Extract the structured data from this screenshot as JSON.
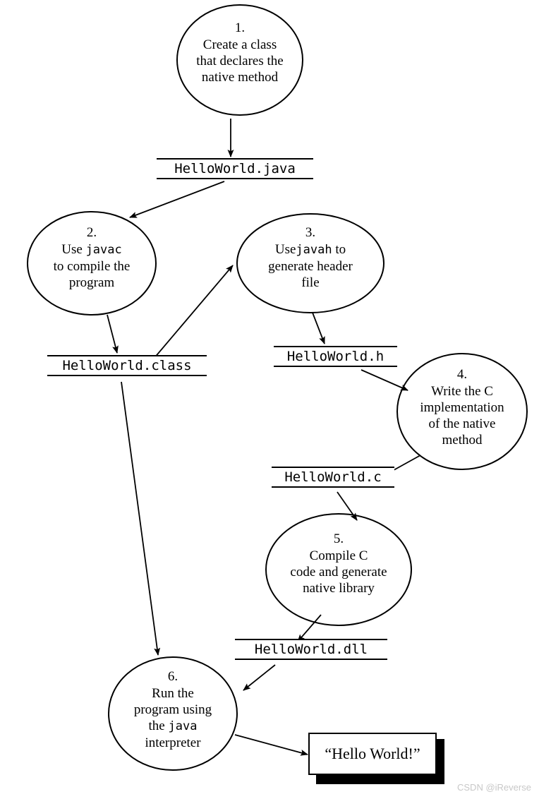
{
  "diagram": {
    "title": "JNI HelloWorld development workflow",
    "stroke_color": "#000000",
    "background_color": "#ffffff",
    "nodes": [
      {
        "id": "step-1",
        "number": "1.",
        "lines": [
          "Create a class",
          "that declares the",
          "native method"
        ],
        "shape": "ellipse"
      },
      {
        "id": "step-2",
        "number": "2.",
        "lines": [
          "Use javac",
          "to compile the",
          "program"
        ],
        "mono_word": "javac",
        "shape": "ellipse"
      },
      {
        "id": "step-3",
        "number": "3.",
        "lines": [
          "Use javah to",
          "generate header",
          "file"
        ],
        "mono_word": "javah",
        "shape": "ellipse"
      },
      {
        "id": "step-4",
        "number": "4.",
        "lines": [
          "Write the C",
          "implementation",
          "of the native",
          "method"
        ],
        "shape": "ellipse"
      },
      {
        "id": "step-5",
        "number": "5.",
        "lines": [
          "Compile C",
          "code and generate",
          "native library"
        ],
        "shape": "ellipse"
      },
      {
        "id": "step-6",
        "number": "6.",
        "lines": [
          "Run the",
          "program using",
          "the java",
          "interpreter"
        ],
        "mono_word": "java",
        "shape": "ellipse"
      }
    ],
    "node_1_num": "1.",
    "node_1_l1": "Create a class",
    "node_1_l2": "that declares the",
    "node_1_l3": "native method",
    "node_2_num": "2.",
    "node_2_l1_a": "Use ",
    "node_2_l1_b": "javac",
    "node_2_l2": "to compile the",
    "node_2_l3": "program",
    "node_3_num": "3.",
    "node_3_l1_a": "Use",
    "node_3_l1_b": "javah",
    "node_3_l1_c": " to",
    "node_3_l2": "generate header",
    "node_3_l3": "file",
    "node_4_num": "4.",
    "node_4_l1": "Write the C",
    "node_4_l2": "implementation",
    "node_4_l3": "of the native",
    "node_4_l4": "method",
    "node_5_num": "5.",
    "node_5_l1": "Compile C",
    "node_5_l2": "code and generate",
    "node_5_l3": "native library",
    "node_6_num": "6.",
    "node_6_l1": "Run the",
    "node_6_l2": "program using",
    "node_6_l3_a": "the ",
    "node_6_l3_b": "java",
    "node_6_l4": "interpreter",
    "files": {
      "java_source": "HelloWorld.java",
      "class_file": "HelloWorld.class",
      "header_file": "HelloWorld.h",
      "c_source": "HelloWorld.c",
      "library_file": "HelloWorld.dll"
    },
    "output": {
      "text": "“Hello World!”"
    },
    "edges": [
      {
        "from": "step-1",
        "to": "java_source"
      },
      {
        "from": "java_source",
        "to": "step-2"
      },
      {
        "from": "step-2",
        "to": "class_file"
      },
      {
        "from": "class_file",
        "to": "step-3"
      },
      {
        "from": "step-3",
        "to": "header_file"
      },
      {
        "from": "header_file",
        "to": "step-4"
      },
      {
        "from": "step-4",
        "to": "c_source"
      },
      {
        "from": "c_source",
        "to": "step-5"
      },
      {
        "from": "step-5",
        "to": "library_file"
      },
      {
        "from": "library_file",
        "to": "step-6"
      },
      {
        "from": "class_file",
        "to": "step-6"
      },
      {
        "from": "step-6",
        "to": "output"
      }
    ]
  },
  "watermark": {
    "text": "CSDN @iReverse"
  }
}
